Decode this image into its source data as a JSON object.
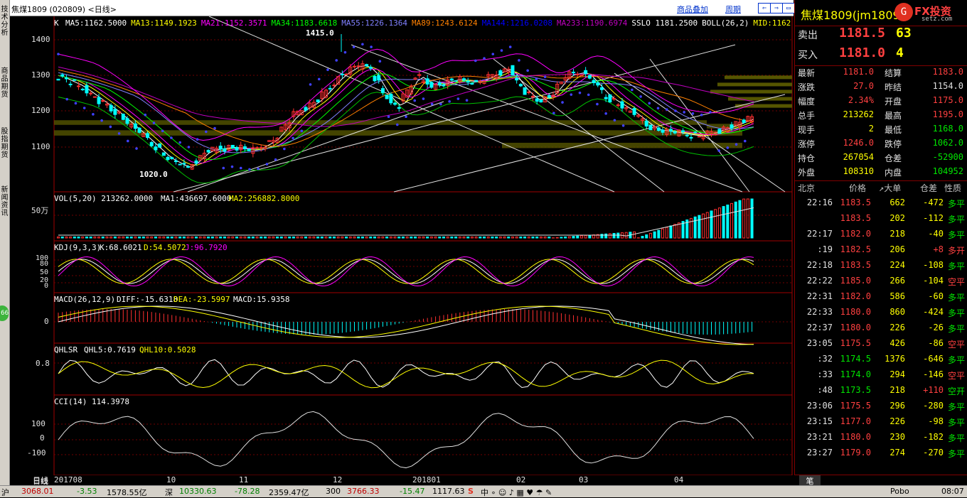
{
  "left_tabs": [
    "技术分析",
    "商品期货",
    "股指期货",
    "新闻资讯"
  ],
  "top": {
    "title": "焦煤1809 (020809) <日线>",
    "links": [
      "商品叠加",
      "周期"
    ],
    "nav_buttons": [
      "⇐",
      "⇒",
      "▭",
      "▭"
    ]
  },
  "main_panel": {
    "label_k": "K",
    "ma_labels": [
      {
        "text": "MA5:1162.5000",
        "color": "#ffffff"
      },
      {
        "text": "MA13:1149.1923",
        "color": "#ffff00"
      },
      {
        "text": "MA21:1152.3571",
        "color": "#ff00ff"
      },
      {
        "text": "MA34:1183.6618",
        "color": "#00ff00"
      },
      {
        "text": "MA55:1226.1364",
        "color": "#8080ff"
      },
      {
        "text": "MA89:1243.6124",
        "color": "#ff8000"
      },
      {
        "text": "MA144:1216.0208",
        "color": "#0000ff"
      },
      {
        "text": "MA233:1190.6974",
        "color": "#c000c0"
      },
      {
        "text": "SSLO 1181.2500",
        "color": "#ffffff"
      },
      {
        "text": "BOLL(26,2)",
        "color": "#ffffff"
      },
      {
        "text": "MID:1162",
        "color": "#ffff00"
      }
    ],
    "y_ticks": [
      "1400",
      "1300",
      "1200",
      "1100"
    ],
    "high_label": "1415.0",
    "low_label": "1020.0"
  },
  "vol_panel": {
    "label": "VOL(5,20) 213262.0000",
    "ma1": "MA1:436697.6000",
    "ma2": "MA2:256882.8000",
    "y_tick": "50万"
  },
  "kdj_panel": {
    "label": "KDJ(9,3,3)",
    "k": "K:68.6021",
    "d": "D:54.5072",
    "j": "J:96.7920",
    "y_ticks": [
      "100",
      "80",
      "50",
      "20",
      "0"
    ]
  },
  "macd_panel": {
    "label": "MACD(26,12,9)",
    "diff": "DIFF:-15.6318",
    "dea": "DEA:-23.5997",
    "macd": "MACD:15.9358",
    "y_tick": "0"
  },
  "qhlsr_panel": {
    "label": "QHLSR",
    "q5": "QHL5:0.7619",
    "q10": "QHL10:0.5028",
    "y_tick": "0.8"
  },
  "cci_panel": {
    "label": "CCI(14) 114.3978",
    "y_ticks": [
      "100",
      "0",
      "-100"
    ]
  },
  "x_axis": {
    "period": "日线",
    "labels": [
      "201708",
      "10",
      "11",
      "12",
      "201801",
      "02",
      "03",
      "04"
    ]
  },
  "quote": {
    "name": "焦煤1809(jm1809)",
    "logo": "FX投资",
    "logo_sub": "setz.com",
    "sell_label": "卖出",
    "sell_price": "1181.5",
    "sell_qty": "63",
    "buy_label": "买入",
    "buy_price": "1181.0",
    "buy_qty": "4",
    "stats": [
      [
        "最新",
        "1181.0",
        "结算",
        "1183.0"
      ],
      [
        "涨跌",
        "27.0",
        "昨结",
        "1154.0"
      ],
      [
        "幅度",
        "2.34%",
        "开盘",
        "1175.0"
      ],
      [
        "总手",
        "213262",
        "最高",
        "1195.0"
      ],
      [
        "现手",
        "2",
        "最低",
        "1168.0"
      ],
      [
        "涨停",
        "1246.0",
        "跌停",
        "1062.0"
      ],
      [
        "持仓",
        "267054",
        "仓差",
        "-52900"
      ],
      [
        "外盘",
        "108310",
        "内盘",
        "104952"
      ]
    ],
    "tick_headers": [
      "北京",
      "价格",
      "↗大单",
      "仓差",
      "性质"
    ],
    "ticks": [
      [
        "22:16",
        "1183.5",
        "662",
        "-472",
        "多平"
      ],
      [
        "",
        "1183.5",
        "202",
        "-112",
        "多平"
      ],
      [
        "22:17",
        "1182.0",
        "218",
        "-40",
        "多平"
      ],
      [
        ":19",
        "1182.5",
        "206",
        "+8",
        "多开"
      ],
      [
        "22:18",
        "1183.5",
        "224",
        "-108",
        "多平"
      ],
      [
        "22:22",
        "1185.0",
        "266",
        "-104",
        "空平"
      ],
      [
        "22:31",
        "1182.0",
        "586",
        "-60",
        "多平"
      ],
      [
        "22:33",
        "1180.0",
        "860",
        "-424",
        "多平"
      ],
      [
        "22:37",
        "1180.0",
        "226",
        "-26",
        "多平"
      ],
      [
        "23:05",
        "1175.5",
        "426",
        "-86",
        "空平"
      ],
      [
        ":32",
        "1174.5",
        "1376",
        "-646",
        "多平"
      ],
      [
        ":33",
        "1174.0",
        "294",
        "-146",
        "空平"
      ],
      [
        ":48",
        "1173.5",
        "218",
        "+110",
        "空开"
      ],
      [
        "23:06",
        "1175.5",
        "296",
        "-280",
        "多平"
      ],
      [
        "23:15",
        "1177.0",
        "226",
        "-98",
        "多平"
      ],
      [
        "23:21",
        "1180.0",
        "230",
        "-182",
        "多平"
      ],
      [
        "23:27",
        "1179.0",
        "274",
        "-270",
        "多平"
      ]
    ],
    "bottom_tab": "笔"
  },
  "status": {
    "items": [
      "沪",
      "3068.01",
      "-3.53",
      "1578.55亿",
      "深",
      "10330.63",
      "-78.28",
      "2359.47亿",
      "300",
      "3766.33",
      "-15.47",
      "1117.63"
    ],
    "right": [
      "Pobo",
      "08:07"
    ]
  }
}
